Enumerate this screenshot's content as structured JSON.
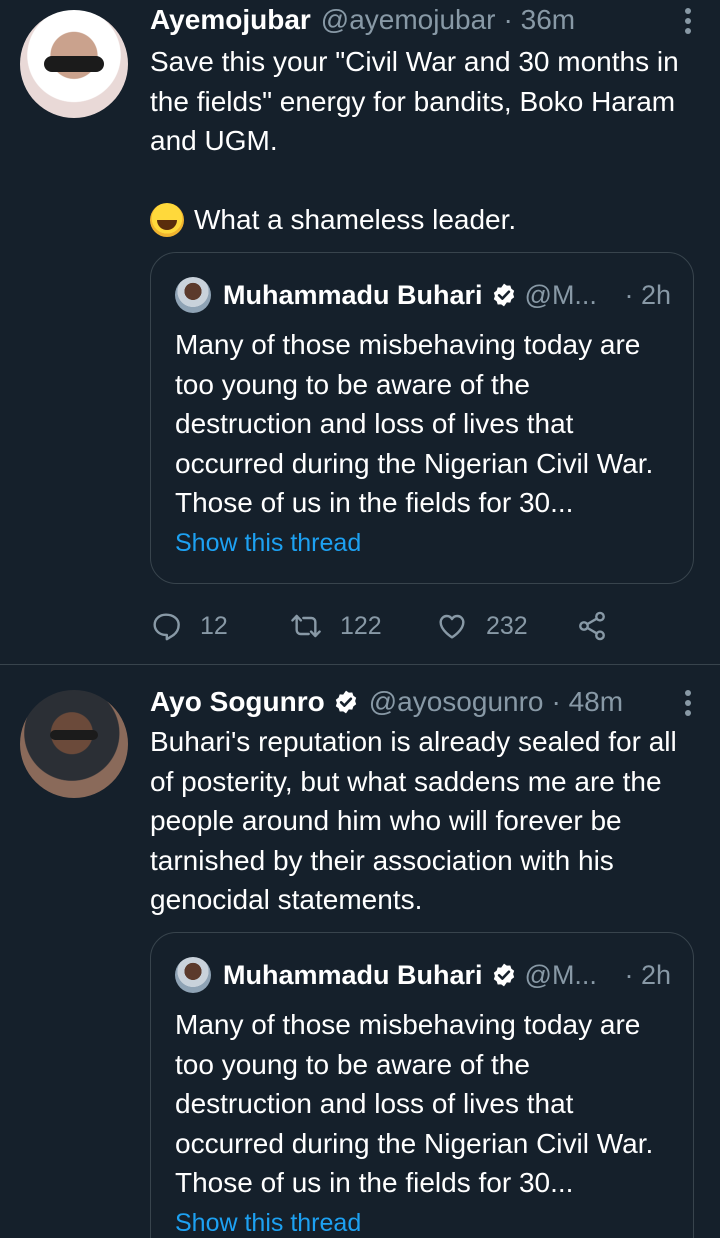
{
  "tweets": [
    {
      "name": "Ayemojubar",
      "handle": "@ayemojubar",
      "time": "· 36m",
      "text": "Save this your \"Civil War and 30 months in the fields\" energy for bandits, Boko Haram and UGM.",
      "text2": "What a shameless leader.",
      "quote": {
        "name": "Muhammadu Buhari",
        "handle": "@M...",
        "time": "· 2h",
        "text": "Many of those misbehaving today are too young to be aware of the destruction and loss of lives that occurred during the Nigerian Civil War. Those of us in the fields for 30...",
        "link": "Show this thread"
      },
      "actions": {
        "replies": "12",
        "retweets": "122",
        "likes": "232"
      }
    },
    {
      "name": "Ayo Sogunro",
      "handle": "@ayosogunro",
      "time": "· 48m",
      "text": "Buhari's reputation is already sealed for all of posterity, but what saddens me are the people around him who will forever be tarnished by their association with his genocidal statements.",
      "quote": {
        "name": "Muhammadu Buhari",
        "handle": "@M...",
        "time": "· 2h",
        "text": "Many of those misbehaving today are too young to be aware of the destruction and loss of lives that occurred during the Nigerian Civil War. Those of us in the fields for 30...",
        "link": "Show this thread"
      }
    }
  ],
  "colors": {
    "background": "#15202b",
    "text": "#ffffff",
    "secondary": "#8899a6",
    "link": "#1da1f2",
    "border": "#38444d"
  },
  "icons": [
    "more-icon",
    "verified-icon",
    "reply-icon",
    "retweet-icon",
    "like-icon",
    "share-icon",
    "laughing-emoji-icon"
  ]
}
